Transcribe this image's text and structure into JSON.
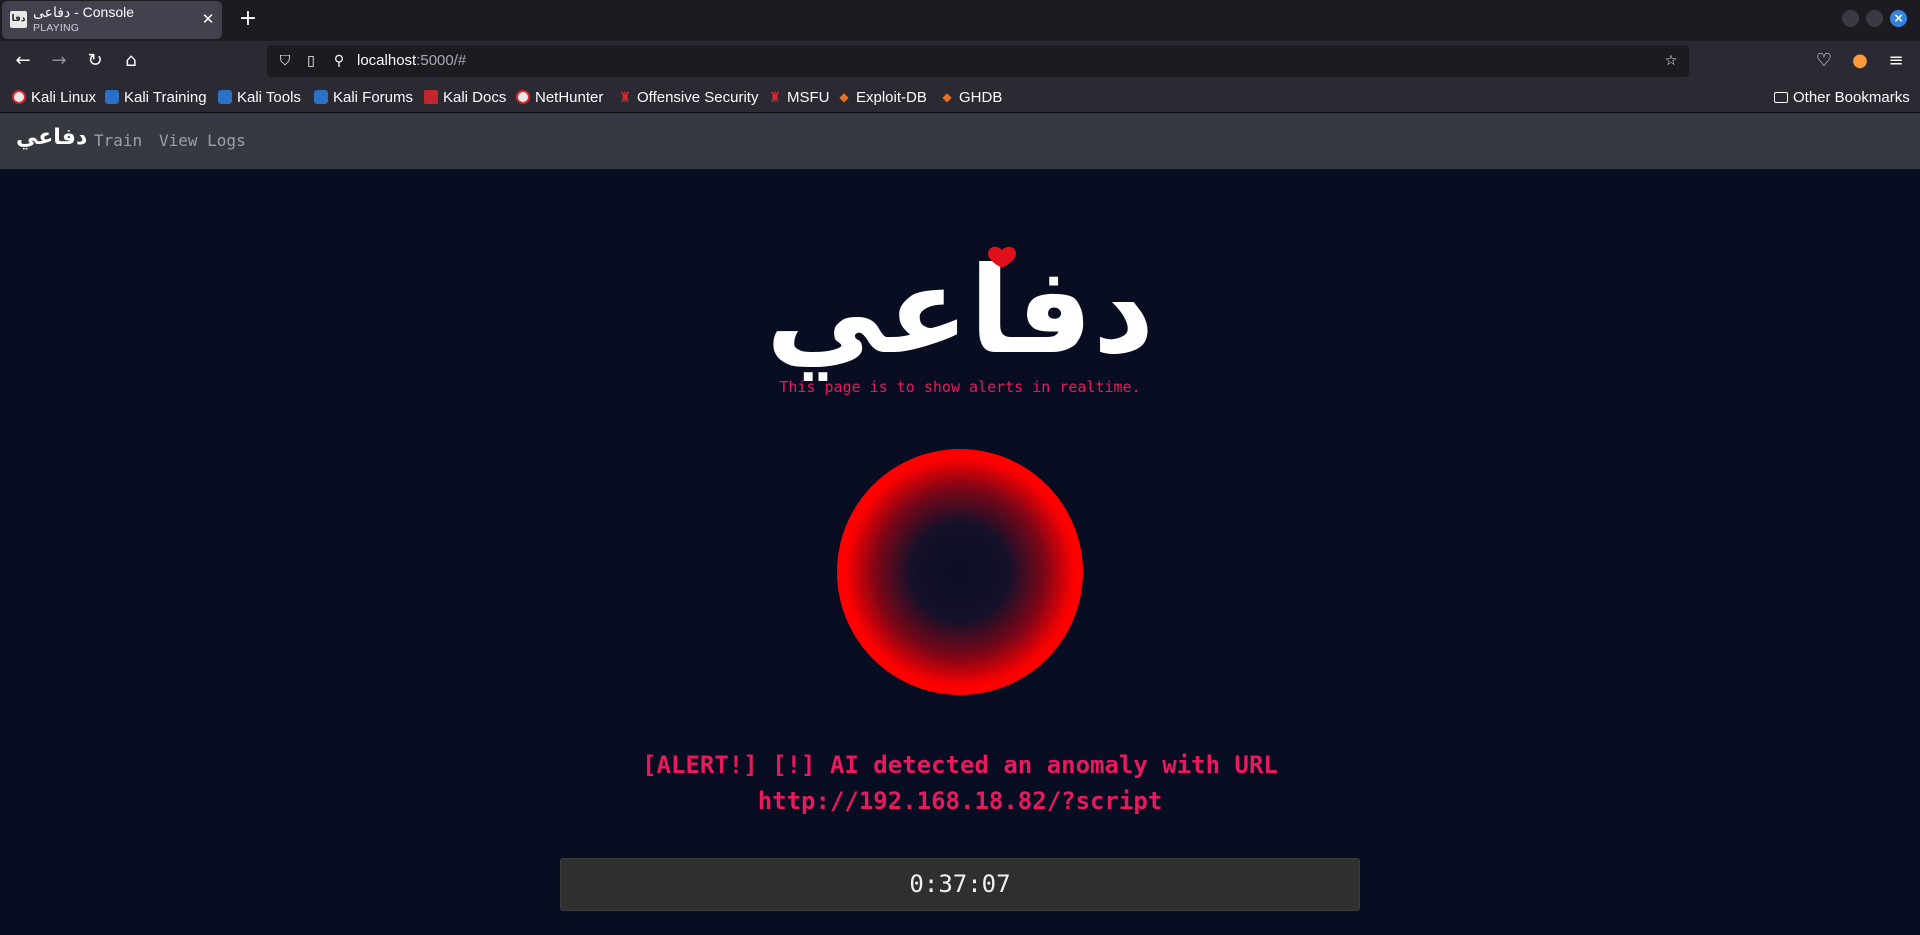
{
  "browser": {
    "tab": {
      "favicon_text": "دفا",
      "title": "دفاعى - Console",
      "subtitle": "PLAYING",
      "close_glyph": "✕"
    },
    "newtab_glyph": "+",
    "url": {
      "host": "localhost",
      "rest": ":5000/#"
    },
    "bookmarks": [
      "Kali Linux",
      "Kali Training",
      "Kali Tools",
      "Kali Forums",
      "Kali Docs",
      "NetHunter",
      "Offensive Security",
      "MSFU",
      "Exploit-DB",
      "GHDB"
    ],
    "other_bookmarks": "Other Bookmarks"
  },
  "app": {
    "brand": "دفاعي",
    "nav": [
      "Train",
      "View Logs"
    ],
    "logo_text": "دفاعي",
    "subtitle": "This page is to show alerts in realtime.",
    "alert_line1": "[ALERT!] [!] AI detected an anomaly with URL",
    "alert_line2": "http://192.168.18.82/?script",
    "timer": "0:37:07"
  },
  "colors": {
    "accent": "#e8195d",
    "ring": "#ff0000",
    "background": "#080d22"
  }
}
